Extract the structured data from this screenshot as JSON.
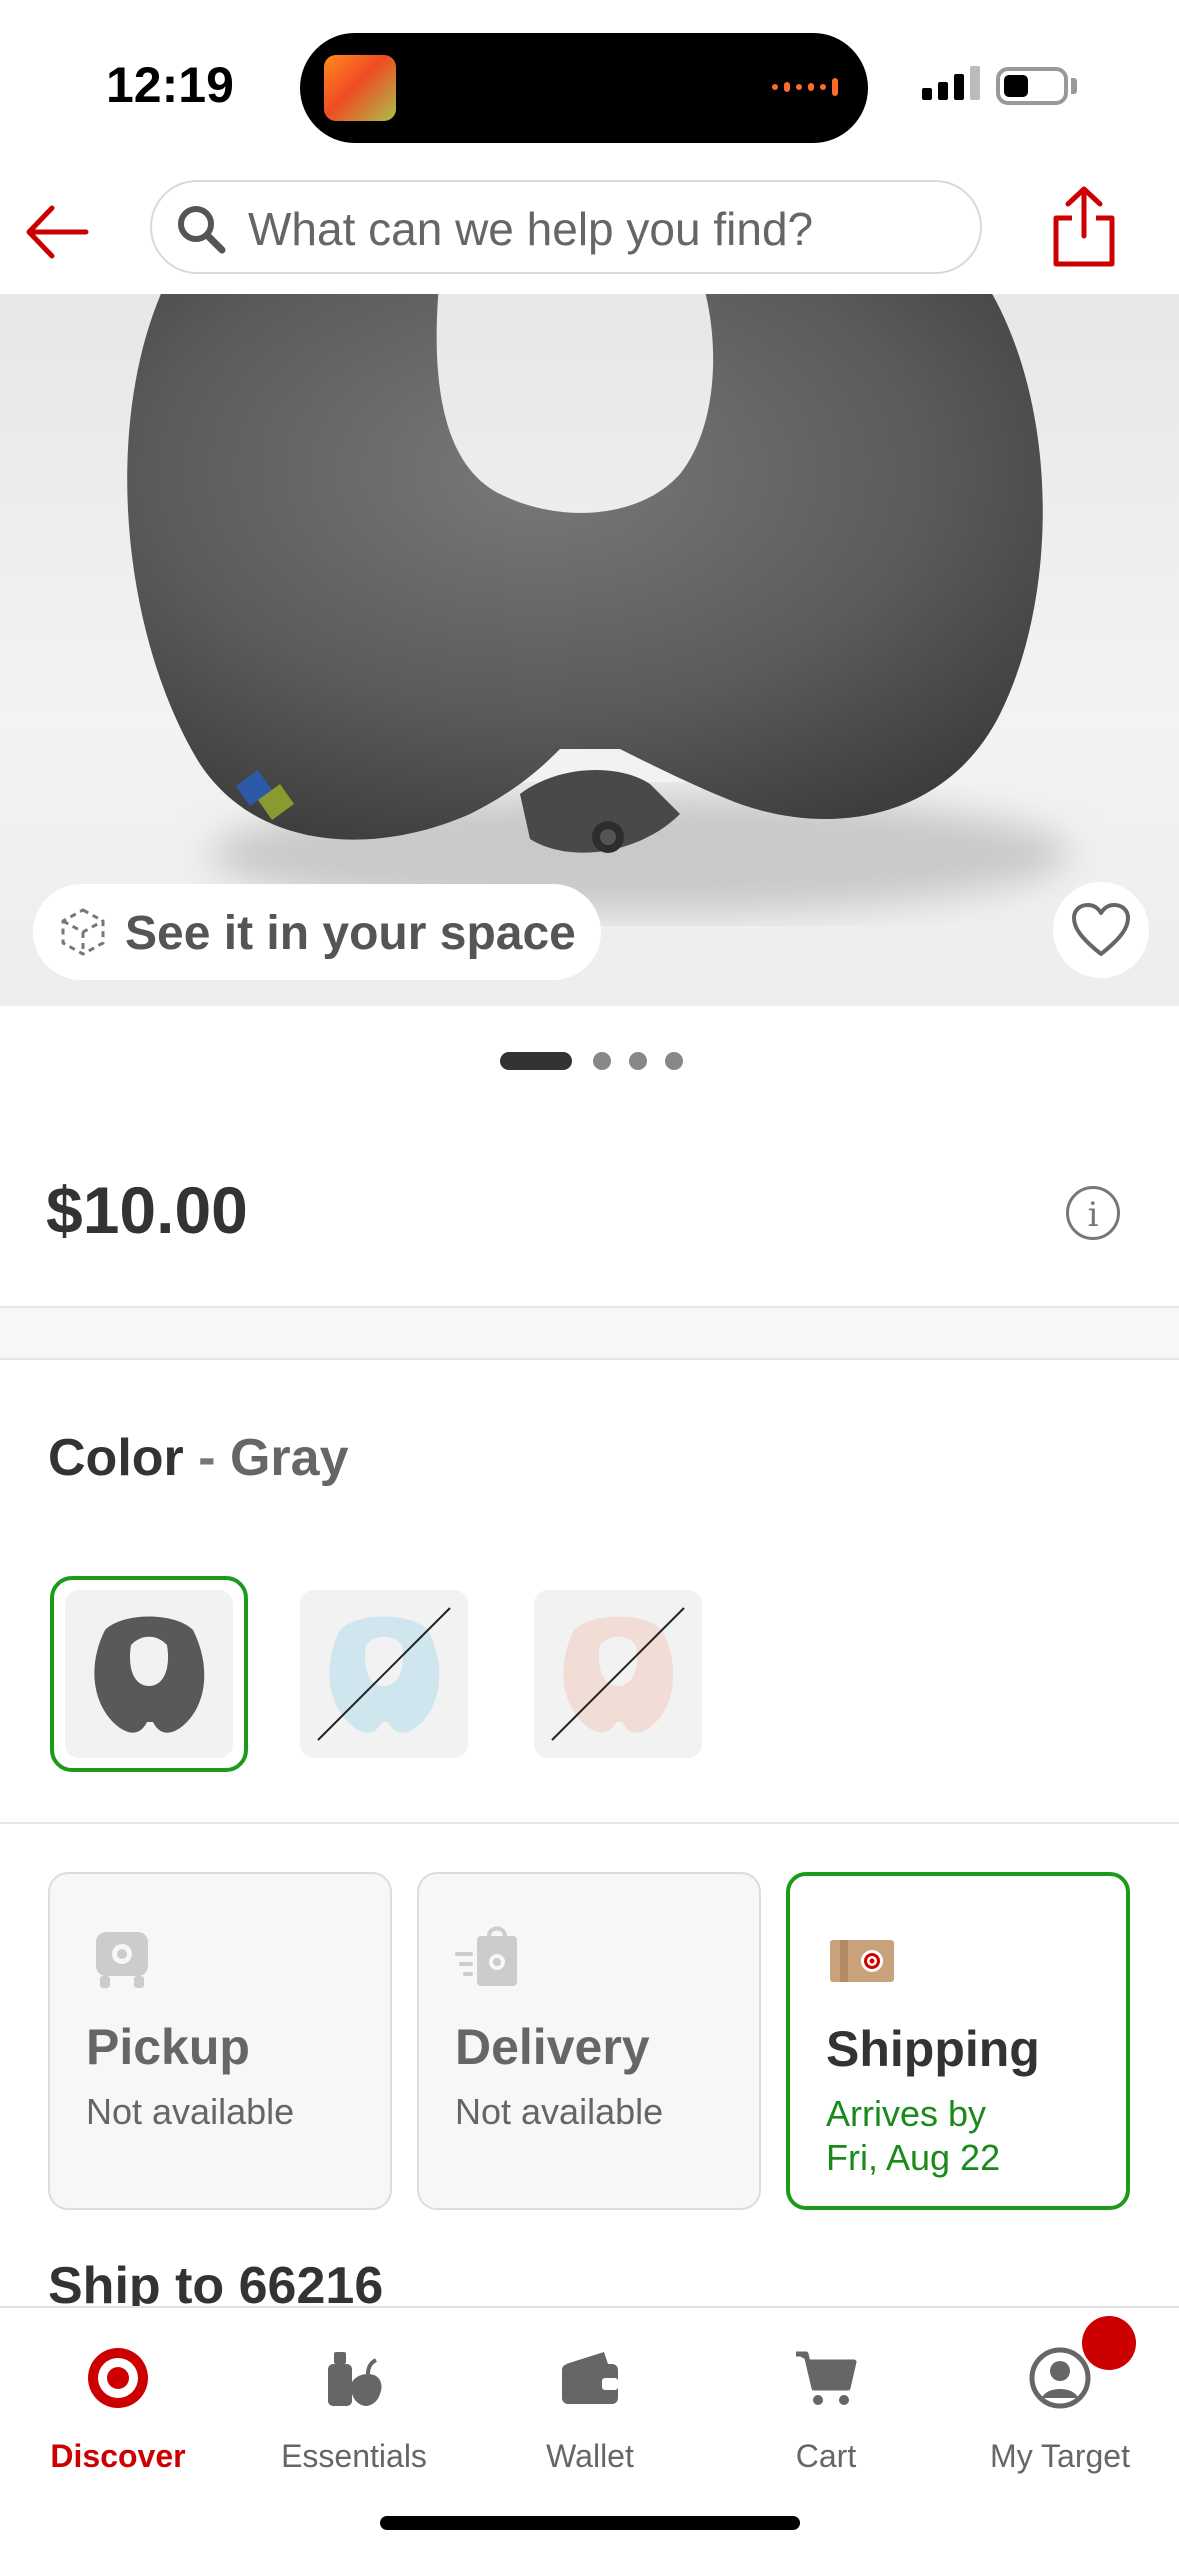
{
  "status_bar": {
    "time": "12:19"
  },
  "header": {
    "search_placeholder": "What can we help you find?",
    "accent_color": "#cc0000"
  },
  "product": {
    "price": "$10.00",
    "image_carousel": {
      "total_pages": 4,
      "current_page": 1
    },
    "see_in_space_label": "See it in your space",
    "favorite_icon": "heart-outline-icon"
  },
  "color_selector": {
    "label": "Color",
    "separator": " - ",
    "selected_value": "Gray",
    "swatches": [
      {
        "color": "Gray",
        "hex": "#5a5858",
        "available": true,
        "selected": true
      },
      {
        "color": "Light Blue",
        "hex": "#cfe6ee",
        "available": false,
        "selected": false
      },
      {
        "color": "Blush",
        "hex": "#f1ddd6",
        "available": false,
        "selected": false
      }
    ]
  },
  "fulfillment": {
    "options": [
      {
        "title": "Pickup",
        "subtitle": "Not available",
        "selected": false,
        "icon": "car-pickup-icon"
      },
      {
        "title": "Delivery",
        "subtitle": "Not available",
        "selected": false,
        "icon": "delivery-bag-icon"
      },
      {
        "title": "Shipping",
        "subtitle_line1": "Arrives by",
        "subtitle_line2": "Fri, Aug 22",
        "selected": true,
        "icon": "shipping-box-icon"
      }
    ],
    "selected_color": "#1a9b1a"
  },
  "ship_to": "Ship to 66216",
  "tab_bar": {
    "tabs": [
      {
        "label": "Discover",
        "icon": "target-bullseye-icon",
        "active": true
      },
      {
        "label": "Essentials",
        "icon": "essentials-icon",
        "active": false
      },
      {
        "label": "Wallet",
        "icon": "wallet-icon",
        "active": false
      },
      {
        "label": "Cart",
        "icon": "cart-icon",
        "active": false
      },
      {
        "label": "My Target",
        "icon": "profile-icon",
        "active": false,
        "has_badge": true
      }
    ]
  }
}
